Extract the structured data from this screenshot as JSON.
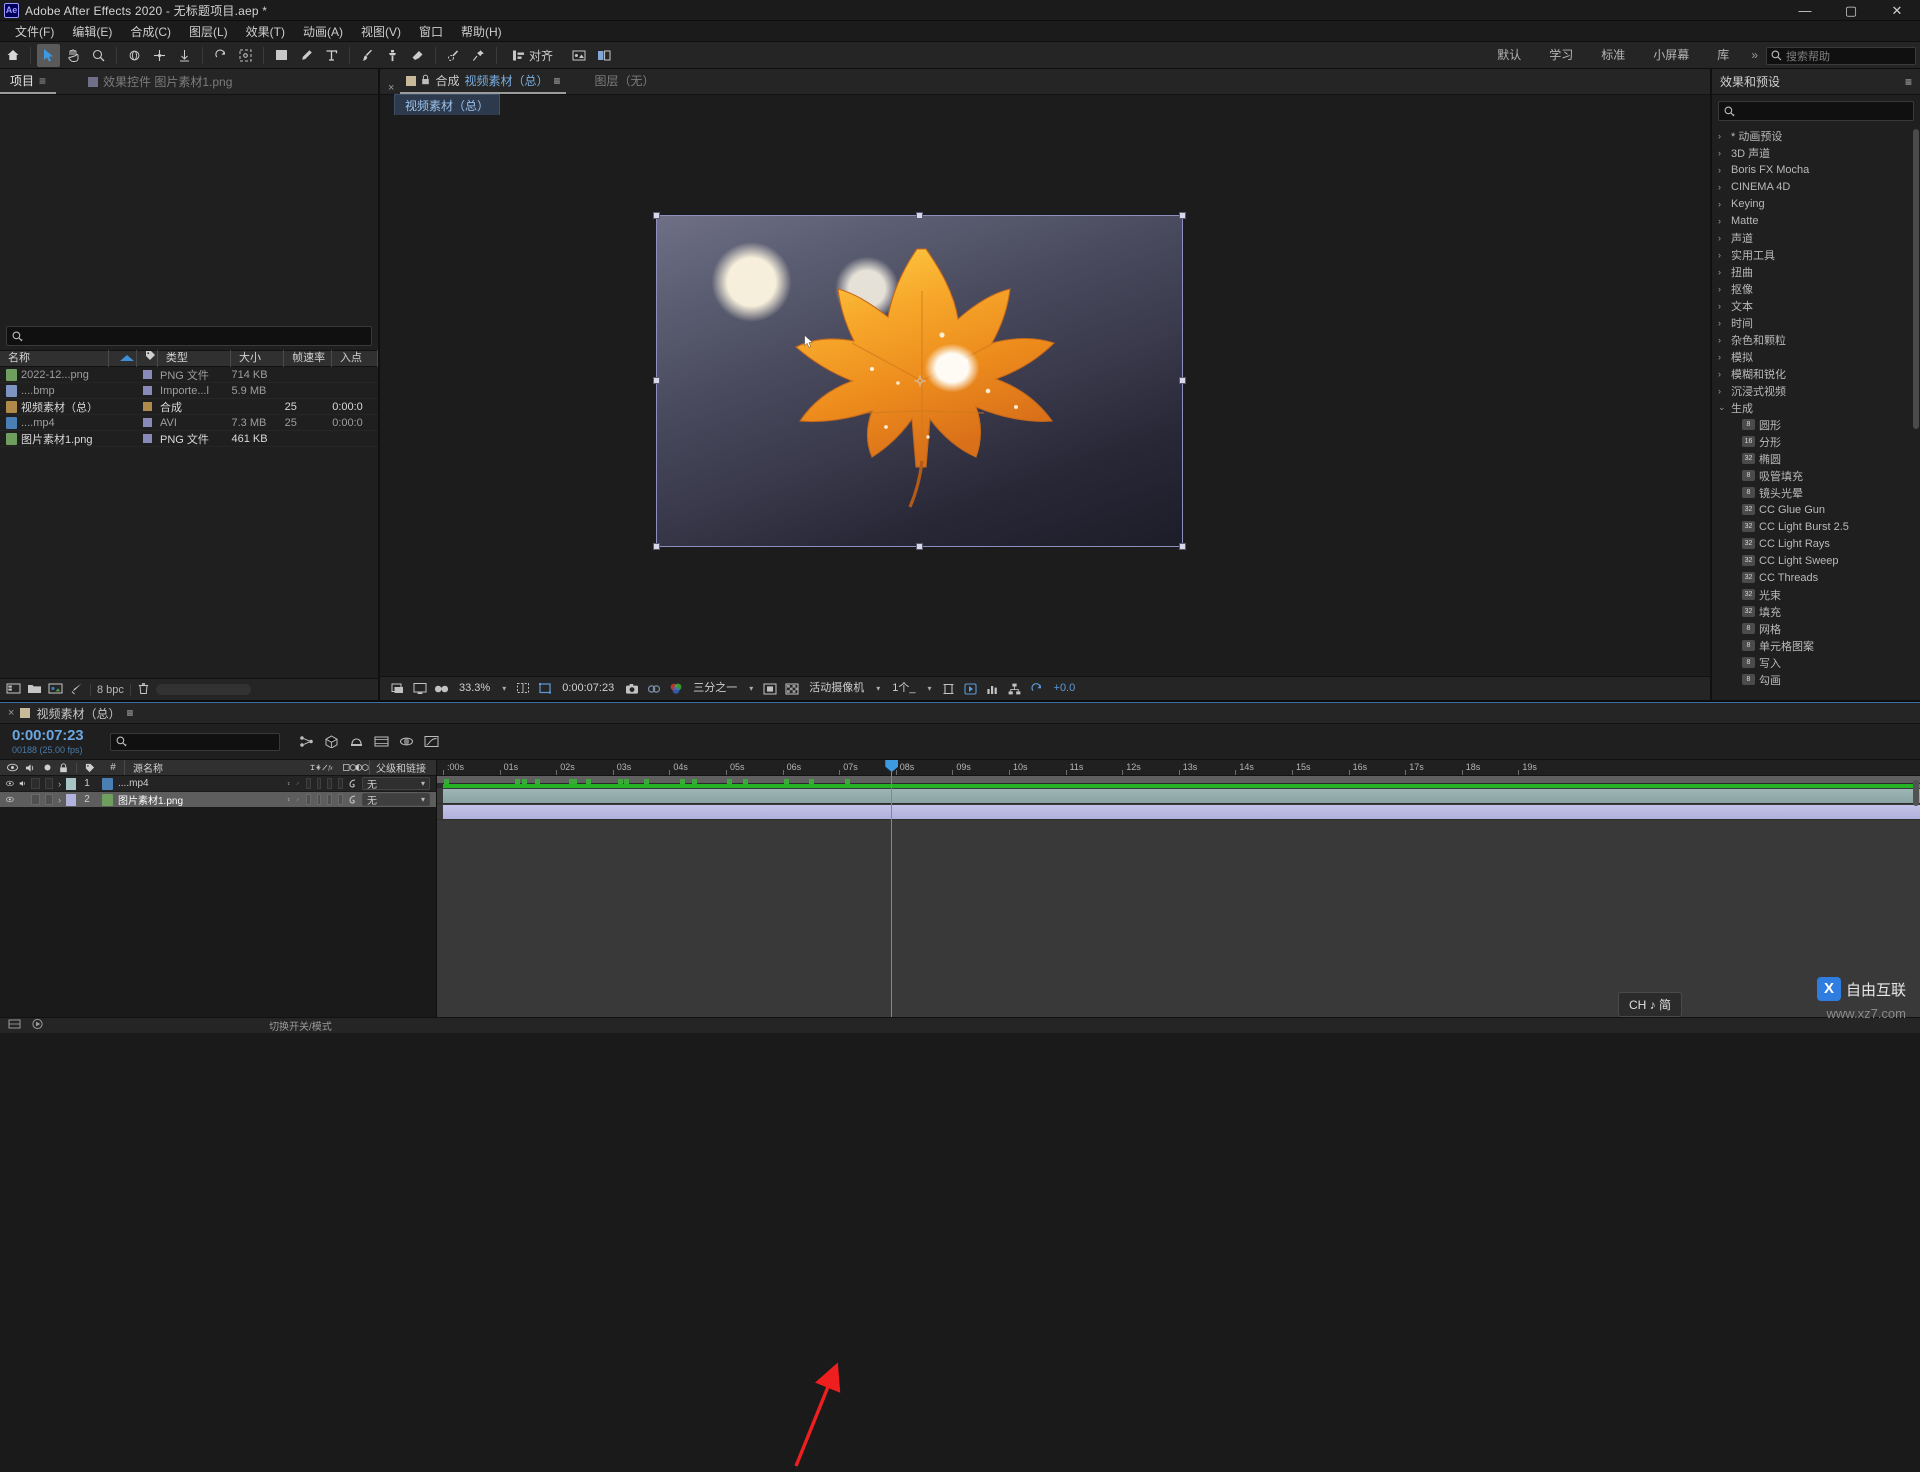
{
  "titlebar": {
    "logo": "Ae",
    "title": "Adobe After Effects 2020 - 无标题项目.aep *",
    "minimize": "—",
    "maximize": "▢",
    "close": "✕"
  },
  "menubar": {
    "items": [
      "文件(F)",
      "编辑(E)",
      "合成(C)",
      "图层(L)",
      "效果(T)",
      "动画(A)",
      "视图(V)",
      "窗口",
      "帮助(H)"
    ]
  },
  "toolbar": {
    "align_label": "对齐",
    "workspaces": [
      "默认",
      "学习",
      "标准",
      "小屏幕",
      "库"
    ],
    "more": "»",
    "help_placeholder": "搜索帮助"
  },
  "project_panel": {
    "tab_project": "项目",
    "tab_effect_controls": "效果控件 图片素材1.png",
    "search_placeholder": "",
    "columns": [
      "名称",
      "",
      "类型",
      "大小",
      "帧速率",
      "入点"
    ],
    "rows": [
      {
        "name": "2022-12...png",
        "type": "PNG 文件",
        "size": "714 KB",
        "fps": "",
        "in": "",
        "icon": "#6f9f5f"
      },
      {
        "name": "....bmp",
        "type": "Importe...l",
        "size": "5.9 MB",
        "fps": "",
        "in": "",
        "icon": "#7d94c4"
      },
      {
        "name": "视频素材（总）",
        "type": "合成",
        "size": "",
        "fps": "25",
        "in": "0:00:0",
        "icon": "#b08a4a"
      },
      {
        "name": "....mp4",
        "type": "AVI",
        "size": "7.3 MB",
        "fps": "25",
        "in": "0:00:0",
        "icon": "#4a7fb5"
      },
      {
        "name": "图片素材1.png",
        "type": "PNG 文件",
        "size": "461 KB",
        "fps": "",
        "in": "",
        "icon": "#6f9f5f"
      }
    ],
    "bpc": "8 bpc"
  },
  "composition": {
    "tab_close": "×",
    "tab_label": "合成",
    "tab_name": "视频素材（总）",
    "layer_tab": "图层（无）",
    "breadcrumb": "视频素材（总）",
    "toolbar": {
      "zoom": "33.3%",
      "timecode": "0:00:07:23",
      "resolution": "三分之一",
      "camera": "活动摄像机",
      "views": "1个_",
      "exposure": "+0.0"
    }
  },
  "effects_panel": {
    "title": "效果和预设",
    "menu": "≡",
    "search_placeholder": "",
    "groups": [
      {
        "label": "* 动画预设",
        "level": 0,
        "expanded": false
      },
      {
        "label": "3D 声道",
        "level": 0,
        "expanded": false
      },
      {
        "label": "Boris FX Mocha",
        "level": 0,
        "expanded": false
      },
      {
        "label": "CINEMA 4D",
        "level": 0,
        "expanded": false
      },
      {
        "label": "Keying",
        "level": 0,
        "expanded": false
      },
      {
        "label": "Matte",
        "level": 0,
        "expanded": false
      },
      {
        "label": "声道",
        "level": 0,
        "expanded": false
      },
      {
        "label": "实用工具",
        "level": 0,
        "expanded": false
      },
      {
        "label": "扭曲",
        "level": 0,
        "expanded": false
      },
      {
        "label": "抠像",
        "level": 0,
        "expanded": false
      },
      {
        "label": "文本",
        "level": 0,
        "expanded": false
      },
      {
        "label": "时间",
        "level": 0,
        "expanded": false
      },
      {
        "label": "杂色和颗粒",
        "level": 0,
        "expanded": false
      },
      {
        "label": "模拟",
        "level": 0,
        "expanded": false
      },
      {
        "label": "模糊和锐化",
        "level": 0,
        "expanded": false
      },
      {
        "label": "沉浸式视频",
        "level": 0,
        "expanded": false
      },
      {
        "label": "生成",
        "level": 0,
        "expanded": true
      },
      {
        "label": "圆形",
        "level": 1,
        "badge": "8"
      },
      {
        "label": "分形",
        "level": 1,
        "badge": "16"
      },
      {
        "label": "椭圆",
        "level": 1,
        "badge": "32"
      },
      {
        "label": "吸管填充",
        "level": 1,
        "badge": "8"
      },
      {
        "label": "镜头光晕",
        "level": 1,
        "badge": "8"
      },
      {
        "label": "CC Glue Gun",
        "level": 1,
        "badge": "32"
      },
      {
        "label": "CC Light Burst 2.5",
        "level": 1,
        "badge": "32"
      },
      {
        "label": "CC Light Rays",
        "level": 1,
        "badge": "32"
      },
      {
        "label": "CC Light Sweep",
        "level": 1,
        "badge": "32"
      },
      {
        "label": "CC Threads",
        "level": 1,
        "badge": "32"
      },
      {
        "label": "光束",
        "level": 1,
        "badge": "32"
      },
      {
        "label": "填充",
        "level": 1,
        "badge": "32"
      },
      {
        "label": "网格",
        "level": 1,
        "badge": "8"
      },
      {
        "label": "单元格图案",
        "level": 1,
        "badge": "8"
      },
      {
        "label": "写入",
        "level": 1,
        "badge": "8"
      },
      {
        "label": "勾画",
        "level": 1,
        "badge": "8"
      }
    ]
  },
  "timeline": {
    "tab_close": "×",
    "tab_name": "视频素材（总）",
    "tab_menu": "≡",
    "current_time": "0:00:07:23",
    "frame_info": "00188 (25.00 fps)",
    "search_placeholder": "",
    "columns": {
      "number": "#",
      "source_name": "源名称",
      "parent": "父级和链接"
    },
    "layers": [
      {
        "num": "1",
        "name": "....mp4",
        "parent": "无",
        "swatch": "#a9c4c4",
        "selected": false,
        "audio": true
      },
      {
        "num": "2",
        "name": "图片素材1.png",
        "parent": "无",
        "swatch": "#b2b2dd",
        "selected": true,
        "audio": false
      }
    ],
    "ruler_ticks": [
      "00s",
      "01s",
      "02s",
      "03s",
      "04s",
      "05s",
      "06s",
      "07s",
      "08s",
      "09s",
      "10s",
      "11s",
      "12s",
      "13s",
      "14s",
      "15s",
      "16s",
      "17s",
      "18s",
      "19s"
    ],
    "bottom_label": "切换开关/模式"
  },
  "ime": {
    "text": "CH ♪ 简"
  },
  "watermarks": {
    "brand": "自由互联",
    "site": "www.xz7.com"
  }
}
